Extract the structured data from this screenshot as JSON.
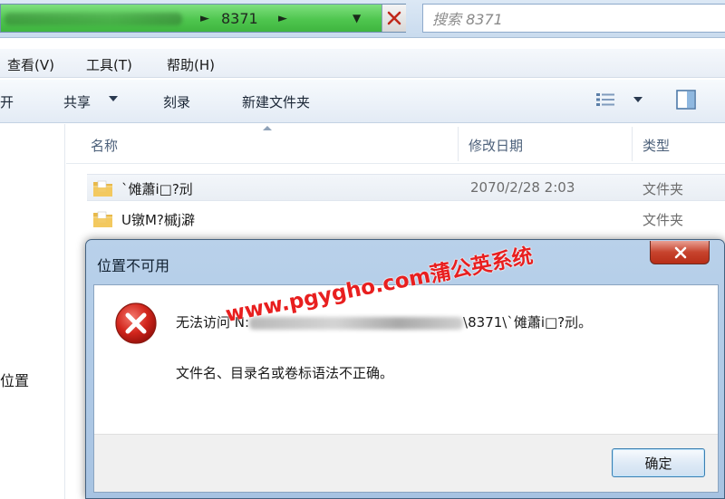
{
  "address_bar": {
    "path_last": "8371",
    "separator": "►"
  },
  "search": {
    "placeholder": "搜索 8371"
  },
  "menu": {
    "items": [
      {
        "label": "查看(V)"
      },
      {
        "label": "工具(T)"
      },
      {
        "label": "帮助(H)"
      }
    ]
  },
  "toolbar": {
    "open_label": "打开",
    "share_label": "共享",
    "burn_label": "刻录",
    "new_folder_label": "新建文件夹"
  },
  "nav": {
    "partial_label": "位置"
  },
  "columns": {
    "name": "名称",
    "modified": "修改日期",
    "type": "类型"
  },
  "files": [
    {
      "name": "`傩蕭i□?刓",
      "date": "2070/2/28 2:03",
      "type": "文件夹"
    },
    {
      "name": "U镦M?槭j澼",
      "date": "",
      "type": "文件夹"
    }
  ],
  "dialog": {
    "title": "位置不可用",
    "message_prefix": "无法访问 N:",
    "message_suffix": "\\8371\\`傩蕭i□?刓。",
    "detail": "文件名、目录名或卷标语法不正确。",
    "ok_label": "确定"
  },
  "watermark": {
    "text": "www.pgygho.com蒲公英系统"
  },
  "colors": {
    "address_highlight": "#4fc64f",
    "dialog_frame": "#b9d1ea",
    "error_red": "#d2261d",
    "watermark_red": "#e81f1f"
  }
}
